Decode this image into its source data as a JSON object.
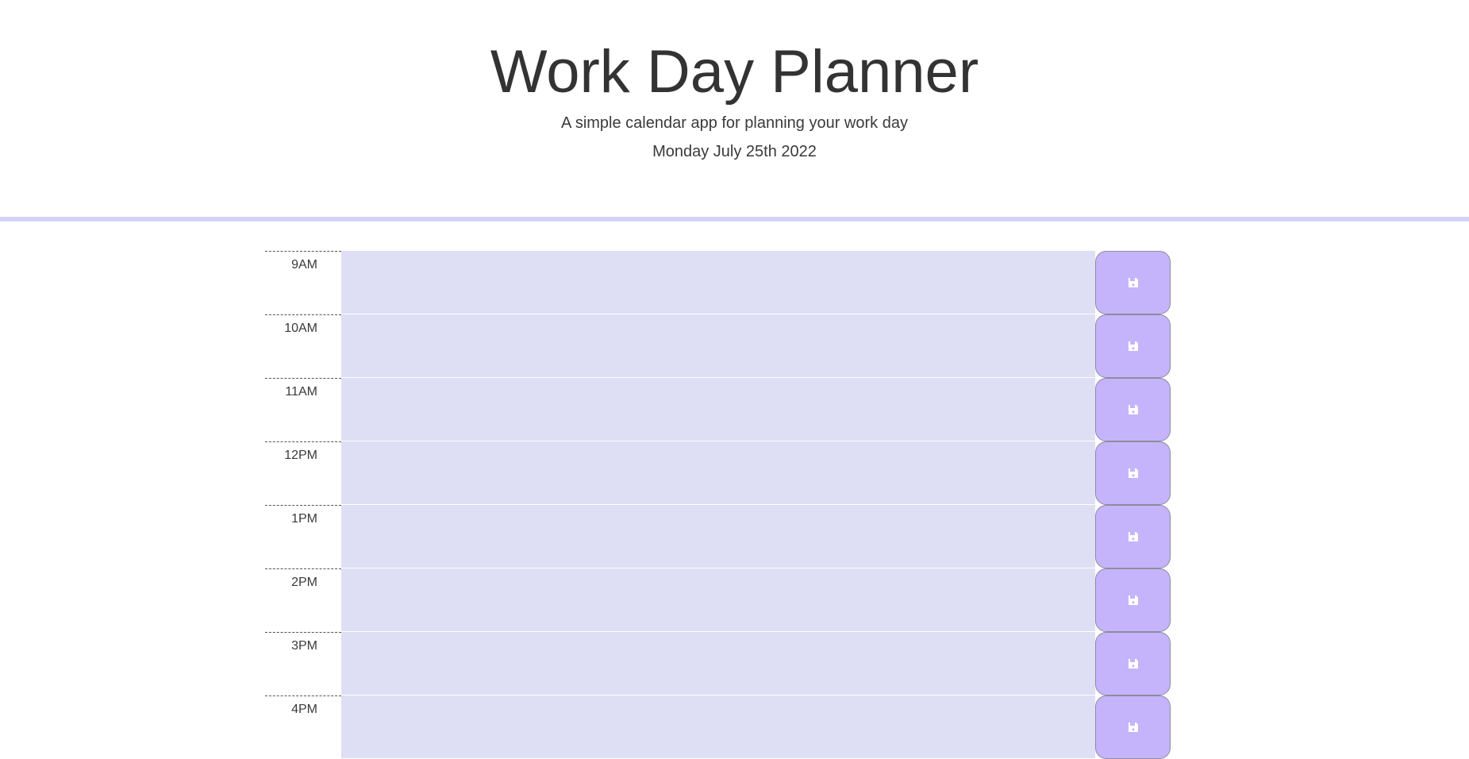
{
  "header": {
    "title": "Work Day Planner",
    "subtitle": "A simple calendar app for planning your work day",
    "current_day": "Monday July 25th 2022"
  },
  "colors": {
    "divider": "#d3d3f8",
    "timeblock_bg": "#dedef4",
    "save_button_bg": "#c5b4fb",
    "save_icon": "#ffffff"
  },
  "timeblocks": [
    {
      "hour": "9AM",
      "text": "",
      "save_icon": "floppy-disk-icon"
    },
    {
      "hour": "10AM",
      "text": "",
      "save_icon": "floppy-disk-icon"
    },
    {
      "hour": "11AM",
      "text": "",
      "save_icon": "floppy-disk-icon"
    },
    {
      "hour": "12PM",
      "text": "",
      "save_icon": "floppy-disk-icon"
    },
    {
      "hour": "1PM",
      "text": "",
      "save_icon": "floppy-disk-icon"
    },
    {
      "hour": "2PM",
      "text": "",
      "save_icon": "floppy-disk-icon"
    },
    {
      "hour": "3PM",
      "text": "",
      "save_icon": "floppy-disk-icon"
    },
    {
      "hour": "4PM",
      "text": "",
      "save_icon": "floppy-disk-icon"
    }
  ]
}
